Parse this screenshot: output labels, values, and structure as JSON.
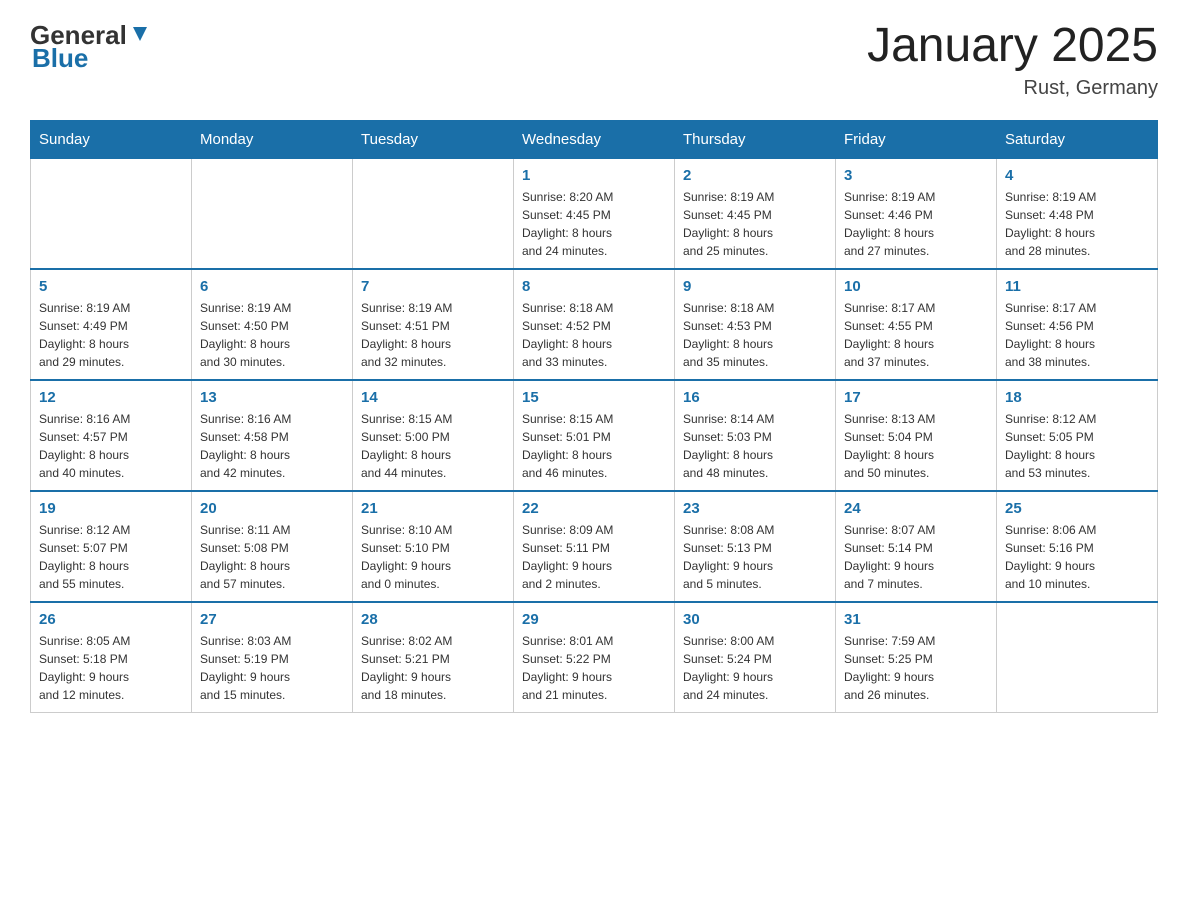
{
  "header": {
    "logo_general": "General",
    "logo_blue": "Blue",
    "title": "January 2025",
    "location": "Rust, Germany"
  },
  "days_of_week": [
    "Sunday",
    "Monday",
    "Tuesday",
    "Wednesday",
    "Thursday",
    "Friday",
    "Saturday"
  ],
  "weeks": [
    [
      {
        "day": "",
        "info": ""
      },
      {
        "day": "",
        "info": ""
      },
      {
        "day": "",
        "info": ""
      },
      {
        "day": "1",
        "info": "Sunrise: 8:20 AM\nSunset: 4:45 PM\nDaylight: 8 hours\nand 24 minutes."
      },
      {
        "day": "2",
        "info": "Sunrise: 8:19 AM\nSunset: 4:45 PM\nDaylight: 8 hours\nand 25 minutes."
      },
      {
        "day": "3",
        "info": "Sunrise: 8:19 AM\nSunset: 4:46 PM\nDaylight: 8 hours\nand 27 minutes."
      },
      {
        "day": "4",
        "info": "Sunrise: 8:19 AM\nSunset: 4:48 PM\nDaylight: 8 hours\nand 28 minutes."
      }
    ],
    [
      {
        "day": "5",
        "info": "Sunrise: 8:19 AM\nSunset: 4:49 PM\nDaylight: 8 hours\nand 29 minutes."
      },
      {
        "day": "6",
        "info": "Sunrise: 8:19 AM\nSunset: 4:50 PM\nDaylight: 8 hours\nand 30 minutes."
      },
      {
        "day": "7",
        "info": "Sunrise: 8:19 AM\nSunset: 4:51 PM\nDaylight: 8 hours\nand 32 minutes."
      },
      {
        "day": "8",
        "info": "Sunrise: 8:18 AM\nSunset: 4:52 PM\nDaylight: 8 hours\nand 33 minutes."
      },
      {
        "day": "9",
        "info": "Sunrise: 8:18 AM\nSunset: 4:53 PM\nDaylight: 8 hours\nand 35 minutes."
      },
      {
        "day": "10",
        "info": "Sunrise: 8:17 AM\nSunset: 4:55 PM\nDaylight: 8 hours\nand 37 minutes."
      },
      {
        "day": "11",
        "info": "Sunrise: 8:17 AM\nSunset: 4:56 PM\nDaylight: 8 hours\nand 38 minutes."
      }
    ],
    [
      {
        "day": "12",
        "info": "Sunrise: 8:16 AM\nSunset: 4:57 PM\nDaylight: 8 hours\nand 40 minutes."
      },
      {
        "day": "13",
        "info": "Sunrise: 8:16 AM\nSunset: 4:58 PM\nDaylight: 8 hours\nand 42 minutes."
      },
      {
        "day": "14",
        "info": "Sunrise: 8:15 AM\nSunset: 5:00 PM\nDaylight: 8 hours\nand 44 minutes."
      },
      {
        "day": "15",
        "info": "Sunrise: 8:15 AM\nSunset: 5:01 PM\nDaylight: 8 hours\nand 46 minutes."
      },
      {
        "day": "16",
        "info": "Sunrise: 8:14 AM\nSunset: 5:03 PM\nDaylight: 8 hours\nand 48 minutes."
      },
      {
        "day": "17",
        "info": "Sunrise: 8:13 AM\nSunset: 5:04 PM\nDaylight: 8 hours\nand 50 minutes."
      },
      {
        "day": "18",
        "info": "Sunrise: 8:12 AM\nSunset: 5:05 PM\nDaylight: 8 hours\nand 53 minutes."
      }
    ],
    [
      {
        "day": "19",
        "info": "Sunrise: 8:12 AM\nSunset: 5:07 PM\nDaylight: 8 hours\nand 55 minutes."
      },
      {
        "day": "20",
        "info": "Sunrise: 8:11 AM\nSunset: 5:08 PM\nDaylight: 8 hours\nand 57 minutes."
      },
      {
        "day": "21",
        "info": "Sunrise: 8:10 AM\nSunset: 5:10 PM\nDaylight: 9 hours\nand 0 minutes."
      },
      {
        "day": "22",
        "info": "Sunrise: 8:09 AM\nSunset: 5:11 PM\nDaylight: 9 hours\nand 2 minutes."
      },
      {
        "day": "23",
        "info": "Sunrise: 8:08 AM\nSunset: 5:13 PM\nDaylight: 9 hours\nand 5 minutes."
      },
      {
        "day": "24",
        "info": "Sunrise: 8:07 AM\nSunset: 5:14 PM\nDaylight: 9 hours\nand 7 minutes."
      },
      {
        "day": "25",
        "info": "Sunrise: 8:06 AM\nSunset: 5:16 PM\nDaylight: 9 hours\nand 10 minutes."
      }
    ],
    [
      {
        "day": "26",
        "info": "Sunrise: 8:05 AM\nSunset: 5:18 PM\nDaylight: 9 hours\nand 12 minutes."
      },
      {
        "day": "27",
        "info": "Sunrise: 8:03 AM\nSunset: 5:19 PM\nDaylight: 9 hours\nand 15 minutes."
      },
      {
        "day": "28",
        "info": "Sunrise: 8:02 AM\nSunset: 5:21 PM\nDaylight: 9 hours\nand 18 minutes."
      },
      {
        "day": "29",
        "info": "Sunrise: 8:01 AM\nSunset: 5:22 PM\nDaylight: 9 hours\nand 21 minutes."
      },
      {
        "day": "30",
        "info": "Sunrise: 8:00 AM\nSunset: 5:24 PM\nDaylight: 9 hours\nand 24 minutes."
      },
      {
        "day": "31",
        "info": "Sunrise: 7:59 AM\nSunset: 5:25 PM\nDaylight: 9 hours\nand 26 minutes."
      },
      {
        "day": "",
        "info": ""
      }
    ]
  ]
}
